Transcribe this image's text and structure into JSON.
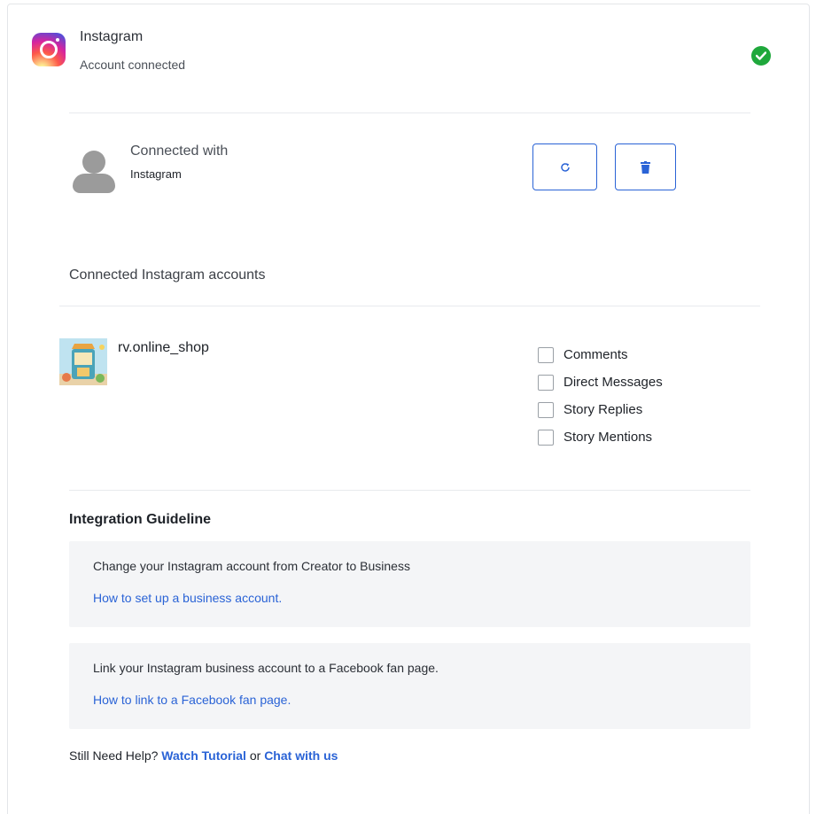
{
  "header": {
    "title": "Instagram",
    "subtitle": "Account connected",
    "status_icon": "check-circle-icon",
    "status_color": "#1fa83c",
    "logo_icon": "instagram-logo-icon"
  },
  "connection": {
    "title": "Connected with",
    "platform": "Instagram",
    "refresh_icon": "refresh-icon",
    "delete_icon": "trash-icon",
    "accent_color": "#2a63d6"
  },
  "accounts_section": {
    "title": "Connected Instagram accounts",
    "accounts": [
      {
        "name": "rv.online_shop",
        "options": [
          {
            "label": "Comments",
            "checked": false
          },
          {
            "label": "Direct Messages",
            "checked": false
          },
          {
            "label": "Story Replies",
            "checked": false
          },
          {
            "label": "Story Mentions",
            "checked": false
          }
        ]
      }
    ]
  },
  "guideline": {
    "title": "Integration Guideline",
    "steps": [
      {
        "text": "Change your Instagram account from Creator to Business",
        "link": "How to set up a business account."
      },
      {
        "text": "Link your Instagram business account to a Facebook fan page.",
        "link": "How to link to a Facebook fan page."
      }
    ]
  },
  "help": {
    "prefix": "Still Need Help?",
    "tutorial_link": "Watch Tutorial",
    "or_text": "or",
    "chat_link": "Chat with us"
  }
}
